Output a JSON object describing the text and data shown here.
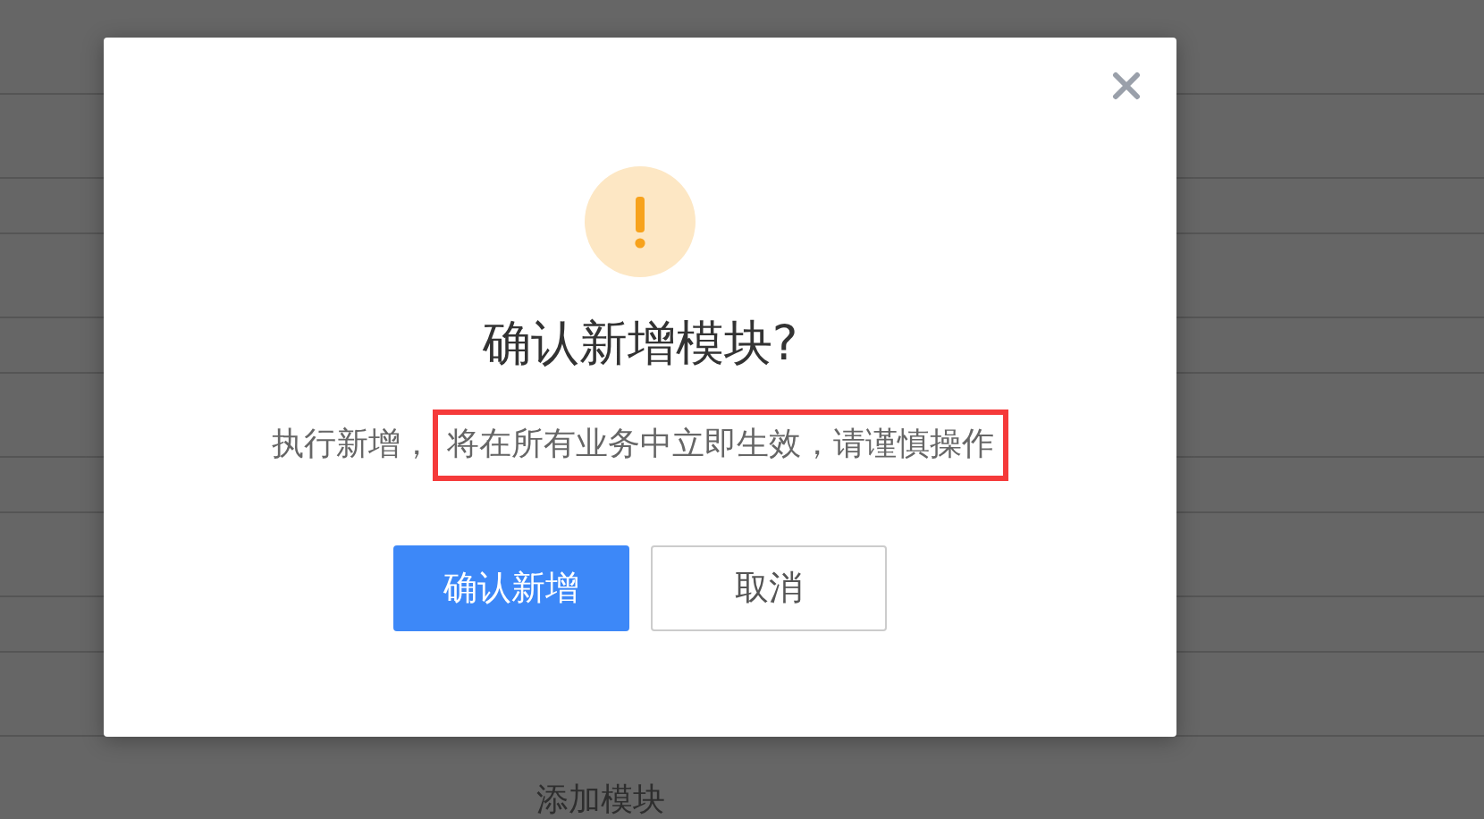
{
  "background": {
    "add_module_label": "添加模块"
  },
  "dialog": {
    "title": "确认新增模块?",
    "message": [
      {
        "text": "执行新增，",
        "highlighted": false
      },
      {
        "text": "将在所有业务中立即生效，请谨慎操作",
        "highlighted": true
      }
    ],
    "buttons": [
      {
        "label": "确认新增",
        "kind": "primary"
      },
      {
        "label": "取消",
        "kind": "default"
      }
    ]
  }
}
